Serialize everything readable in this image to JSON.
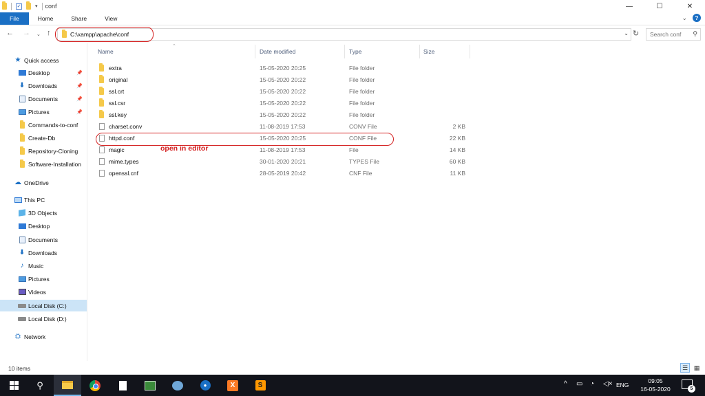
{
  "window": {
    "title": "conf",
    "controls": {
      "minimize": "—",
      "maximize": "☐",
      "close": "✕"
    }
  },
  "ribbon": {
    "tabs": [
      "File",
      "Home",
      "Share",
      "View"
    ]
  },
  "address": {
    "path": "C:\\xampp\\apache\\conf",
    "search_placeholder": "Search conf"
  },
  "nav": {
    "quick_access": "Quick access",
    "quick_items": [
      "Desktop",
      "Downloads",
      "Documents",
      "Pictures",
      "Commands-to-conf",
      "Create-Db",
      "Repository-Cloning",
      "Software-Installation"
    ],
    "onedrive": "OneDrive",
    "this_pc": "This PC",
    "pc_items": [
      "3D Objects",
      "Desktop",
      "Documents",
      "Downloads",
      "Music",
      "Pictures",
      "Videos",
      "Local Disk (C:)",
      "Local Disk (D:)"
    ],
    "network": "Network"
  },
  "columns": {
    "name": "Name",
    "date": "Date modified",
    "type": "Type",
    "size": "Size"
  },
  "files": [
    {
      "name": "extra",
      "date": "15-05-2020 20:25",
      "type": "File folder",
      "size": "",
      "kind": "folder"
    },
    {
      "name": "original",
      "date": "15-05-2020 20:22",
      "type": "File folder",
      "size": "",
      "kind": "folder"
    },
    {
      "name": "ssl.crt",
      "date": "15-05-2020 20:22",
      "type": "File folder",
      "size": "",
      "kind": "folder"
    },
    {
      "name": "ssl.csr",
      "date": "15-05-2020 20:22",
      "type": "File folder",
      "size": "",
      "kind": "folder"
    },
    {
      "name": "ssl.key",
      "date": "15-05-2020 20:22",
      "type": "File folder",
      "size": "",
      "kind": "folder"
    },
    {
      "name": "charset.conv",
      "date": "11-08-2019 17:53",
      "type": "CONV File",
      "size": "2 KB",
      "kind": "file"
    },
    {
      "name": "httpd.conf",
      "date": "15-05-2020 20:25",
      "type": "CONF File",
      "size": "22 KB",
      "kind": "file"
    },
    {
      "name": "magic",
      "date": "11-08-2019 17:53",
      "type": "File",
      "size": "14 KB",
      "kind": "file"
    },
    {
      "name": "mime.types",
      "date": "30-01-2020 20:21",
      "type": "TYPES File",
      "size": "60 KB",
      "kind": "file"
    },
    {
      "name": "openssl.cnf",
      "date": "28-05-2019 20:42",
      "type": "CNF File",
      "size": "11 KB",
      "kind": "file"
    }
  ],
  "annotation": "open in editor",
  "status": {
    "items": "10 items"
  },
  "taskbar": {
    "lang": "ENG",
    "time": "09:05",
    "date": "16-05-2020",
    "notifications": "5"
  },
  "colors": {
    "accent": "#1a6fc4",
    "annotation": "#d42020",
    "selection": "#cce4f7"
  }
}
